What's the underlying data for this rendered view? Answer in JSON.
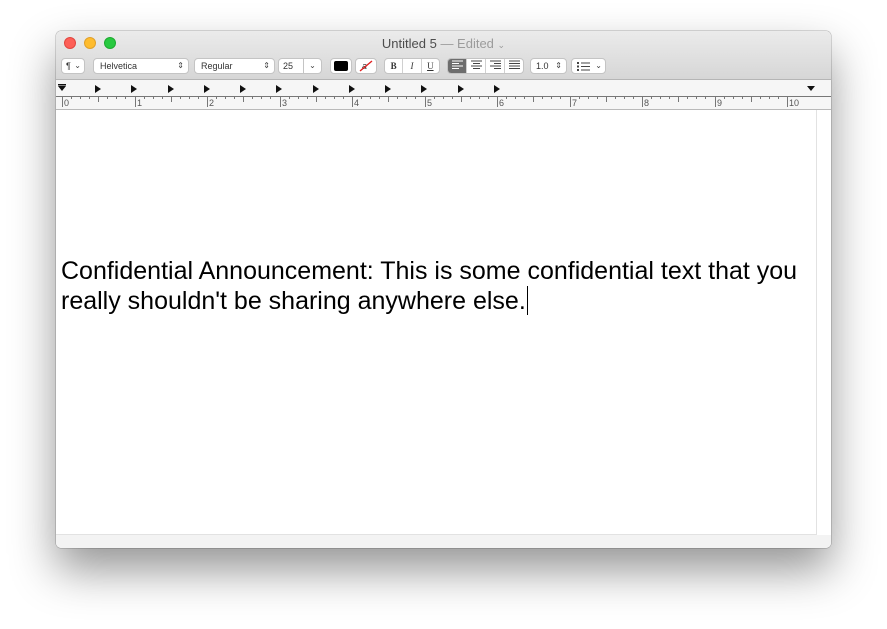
{
  "window": {
    "title": "Untitled 5",
    "edited_suffix": "— Edited",
    "title_chevron": "chevron-down-icon"
  },
  "toolbar": {
    "paragraph_style_icon": "pilcrow-icon",
    "font_family": "Helvetica",
    "font_style": "Regular",
    "font_size": "25",
    "text_color": "#000000",
    "highlight_label": "a",
    "bold_label": "B",
    "italic_label": "I",
    "underline_label": "U",
    "line_spacing": "1.0",
    "list_icon": "list-bullets-icon"
  },
  "ruler": {
    "numbers": [
      "0",
      "1",
      "2",
      "3",
      "4",
      "5",
      "6",
      "7",
      "8",
      "9",
      "10"
    ]
  },
  "document": {
    "text": "Confidential Announcement: This is some confidential text that you really shouldn't be sharing anywhere else."
  },
  "colors": {
    "close": "#fd5f57",
    "minimize": "#febc2e",
    "maximize": "#28c940",
    "align_selected": "#6d6d6d"
  }
}
